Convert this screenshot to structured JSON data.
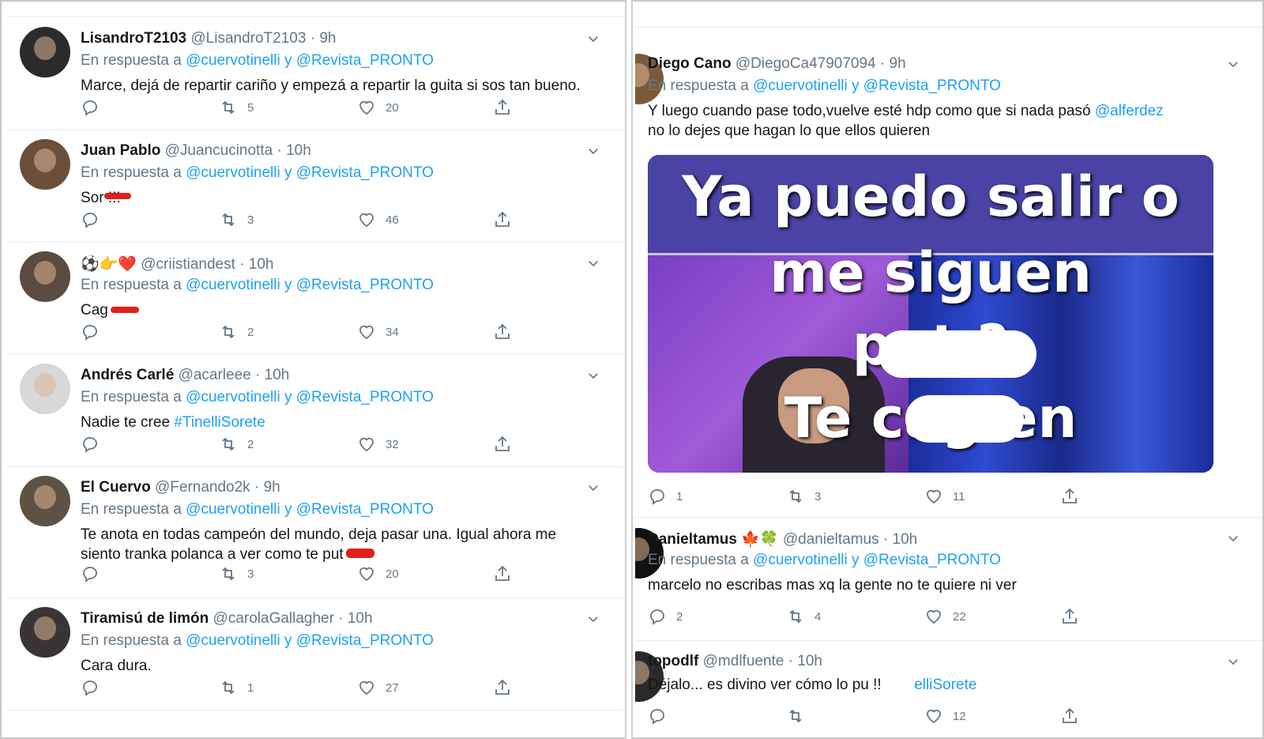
{
  "left": {
    "tweets": [
      {
        "name": "LisandroT2103",
        "handle": "@LisandroT2103",
        "time": "· 9h",
        "reply_prefix": "En respuesta a",
        "reply_to": "@cuervotinelli y @Revista_PRONTO",
        "text": "Marce, dejá de repartir cariño y empezá a repartir la guita si sos tan bueno.",
        "retweets": "5",
        "likes": "20"
      },
      {
        "name": "Juan Pablo",
        "handle": "@Juancucinotta",
        "time": "· 10h",
        "reply_prefix": "En respuesta a",
        "reply_to": "@cuervotinelli y @Revista_PRONTO",
        "text": "Sor     !!!",
        "retweets": "3",
        "likes": "46"
      },
      {
        "name": "⚽👉❤️",
        "handle": "@criistiandest",
        "time": "· 10h",
        "reply_prefix": "En respuesta a",
        "reply_to": "@cuervotinelli y @Revista_PRONTO",
        "text": "Cag",
        "retweets": "2",
        "likes": "34"
      },
      {
        "name": "Andrés Carlé",
        "handle": "@acarleee",
        "time": "· 10h",
        "reply_prefix": "En respuesta a",
        "reply_to": "@cuervotinelli y @Revista_PRONTO",
        "text": "Nadie te cree ",
        "hashtag": "#TinelliSorete",
        "retweets": "2",
        "likes": "32"
      },
      {
        "name": "El Cuervo",
        "handle": "@Fernando2k",
        "time": "· 9h",
        "reply_prefix": "En respuesta a",
        "reply_to": "@cuervotinelli y @Revista_PRONTO",
        "text": "Te anota en todas campeón del mundo, deja pasar una. Igual ahora me",
        "text2": "siento tranka polanca a ver como te put",
        "retweets": "3",
        "likes": "20"
      },
      {
        "name": "Tiramisú de limón",
        "handle": "@carolaGallagher",
        "time": "· 10h",
        "reply_prefix": "En respuesta a",
        "reply_to": "@cuervotinelli y @Revista_PRONTO",
        "text": "Cara dura.",
        "retweets": "1",
        "likes": "27"
      }
    ]
  },
  "right": {
    "tweets": [
      {
        "name": "Diego Cano",
        "handle": "@DiegoCa47907094",
        "time": "· 9h",
        "reply_prefix": "En respuesta a",
        "reply_to": "@cuervotinelli y @Revista_PRONTO",
        "text": "Y luego cuando pase todo,vuelve esté hdp como que si nada pasó ",
        "mention": "@alferdez",
        "text2": "no lo dejes que hagan lo que ellos quieren",
        "replies": "1",
        "retweets": "3",
        "likes": "11",
        "meme": {
          "line1": "Ya puedo salir o",
          "line2": "me siguen",
          "line3": "put         ?",
          "line4": "Te cag           en"
        }
      },
      {
        "name": "Danieltamus 🍁🍀",
        "handle": "@danieltamus",
        "time": "· 10h",
        "reply_prefix": "En respuesta a",
        "reply_to": "@cuervotinelli y @Revista_PRONTO",
        "text": "marcelo no escribas mas xq la gente no te quiere ni ver",
        "replies": "2",
        "retweets": "4",
        "likes": "22"
      },
      {
        "name": "topodlf",
        "handle": "@mdlfuente",
        "time": "· 10h",
        "text": "Déjalo... es divino ver cómo lo pu        !! ",
        "hashtag": "#TinelliSorete",
        "likes": "12"
      }
    ]
  }
}
